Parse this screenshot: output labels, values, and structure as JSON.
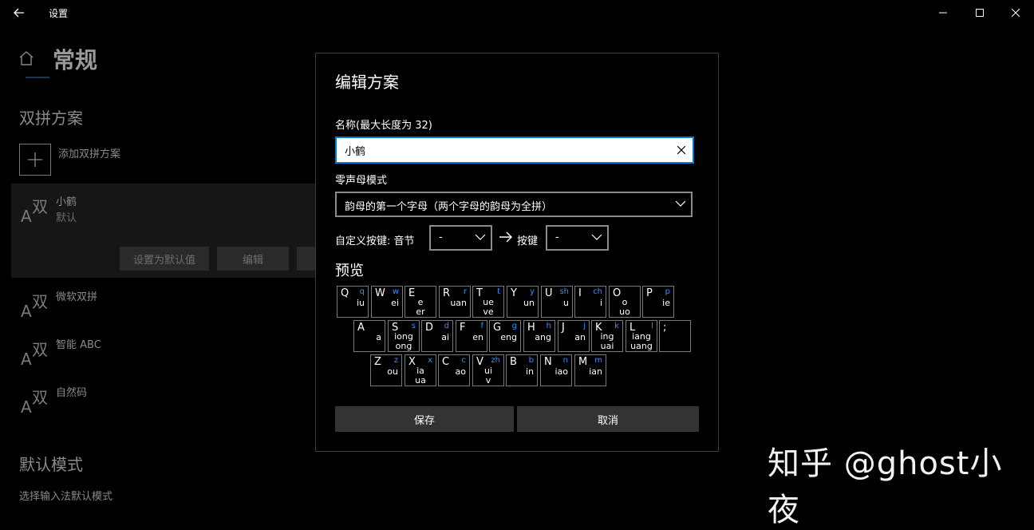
{
  "window": {
    "title": "设置"
  },
  "page": {
    "title": "常规",
    "section_shuangpin": "双拼方案",
    "add_scheme": "添加双拼方案",
    "schemes": [
      {
        "name": "小鹤",
        "sub": "默认"
      },
      {
        "name": "微软双拼"
      },
      {
        "name": "智能 ABC"
      },
      {
        "name": "自然码"
      }
    ],
    "scheme_icon": {
      "zh": "双",
      "en": "A"
    },
    "set_default_button": "设置为默认值",
    "edit_button": "编辑",
    "section_default_mode": "默认模式",
    "default_mode_label": "选择输入法默认模式"
  },
  "watermark": "知乎 @ghost小夜",
  "dialog": {
    "title": "编辑方案",
    "name_label": "名称(最大长度为 32)",
    "name_value": "小鹤",
    "zero_initial_label": "零声母模式",
    "zero_initial_value": "韵母的第一个字母（两个字母的韵母为全拼）",
    "custom_key_label": "自定义按键:",
    "syllable_label": "音节",
    "syllable_value": "-",
    "key_label": "按键",
    "key_value": "-",
    "preview_label": "预览",
    "save_button": "保存",
    "cancel_button": "取消"
  },
  "keyboard": {
    "rows": [
      [
        {
          "key": "Q",
          "initial": "q",
          "finals": [
            "iu"
          ]
        },
        {
          "key": "W",
          "initial": "w",
          "finals": [
            "ei"
          ]
        },
        {
          "key": "E",
          "initial": "",
          "finals": [
            "e",
            "er"
          ]
        },
        {
          "key": "R",
          "initial": "r",
          "finals": [
            "uan"
          ]
        },
        {
          "key": "T",
          "initial": "t",
          "finals": [
            "ue",
            "ve"
          ]
        },
        {
          "key": "Y",
          "initial": "y",
          "finals": [
            "un"
          ]
        },
        {
          "key": "U",
          "initial": "sh",
          "finals": [
            "u"
          ]
        },
        {
          "key": "I",
          "initial": "ch",
          "finals": [
            "i"
          ]
        },
        {
          "key": "O",
          "initial": "",
          "finals": [
            "o",
            "uo"
          ]
        },
        {
          "key": "P",
          "initial": "p",
          "finals": [
            "ie"
          ]
        }
      ],
      [
        {
          "key": "A",
          "initial": "",
          "finals": [
            "a"
          ]
        },
        {
          "key": "S",
          "initial": "s",
          "finals": [
            "iong",
            "ong"
          ]
        },
        {
          "key": "D",
          "initial": "d",
          "finals": [
            "ai"
          ]
        },
        {
          "key": "F",
          "initial": "f",
          "finals": [
            "en"
          ]
        },
        {
          "key": "G",
          "initial": "g",
          "finals": [
            "eng"
          ]
        },
        {
          "key": "H",
          "initial": "h",
          "finals": [
            "ang"
          ]
        },
        {
          "key": "J",
          "initial": "j",
          "finals": [
            "an"
          ]
        },
        {
          "key": "K",
          "initial": "k",
          "finals": [
            "ing",
            "uai"
          ]
        },
        {
          "key": "L",
          "initial": "l",
          "finals": [
            "iang",
            "uang"
          ]
        },
        {
          "key": ";",
          "initial": "",
          "finals": []
        }
      ],
      [
        {
          "key": "Z",
          "initial": "z",
          "finals": [
            "ou"
          ]
        },
        {
          "key": "X",
          "initial": "x",
          "finals": [
            "ia",
            "ua"
          ]
        },
        {
          "key": "C",
          "initial": "c",
          "finals": [
            "ao"
          ]
        },
        {
          "key": "V",
          "initial": "zh",
          "finals": [
            "ui",
            "v"
          ]
        },
        {
          "key": "B",
          "initial": "b",
          "finals": [
            "in"
          ]
        },
        {
          "key": "N",
          "initial": "n",
          "finals": [
            "iao"
          ]
        },
        {
          "key": "M",
          "initial": "m",
          "finals": [
            "ian"
          ]
        }
      ]
    ]
  },
  "colors": {
    "accent": "#0078d7",
    "initial_blue": "#3a8fff",
    "dialog_border": "#3c3c3c"
  }
}
